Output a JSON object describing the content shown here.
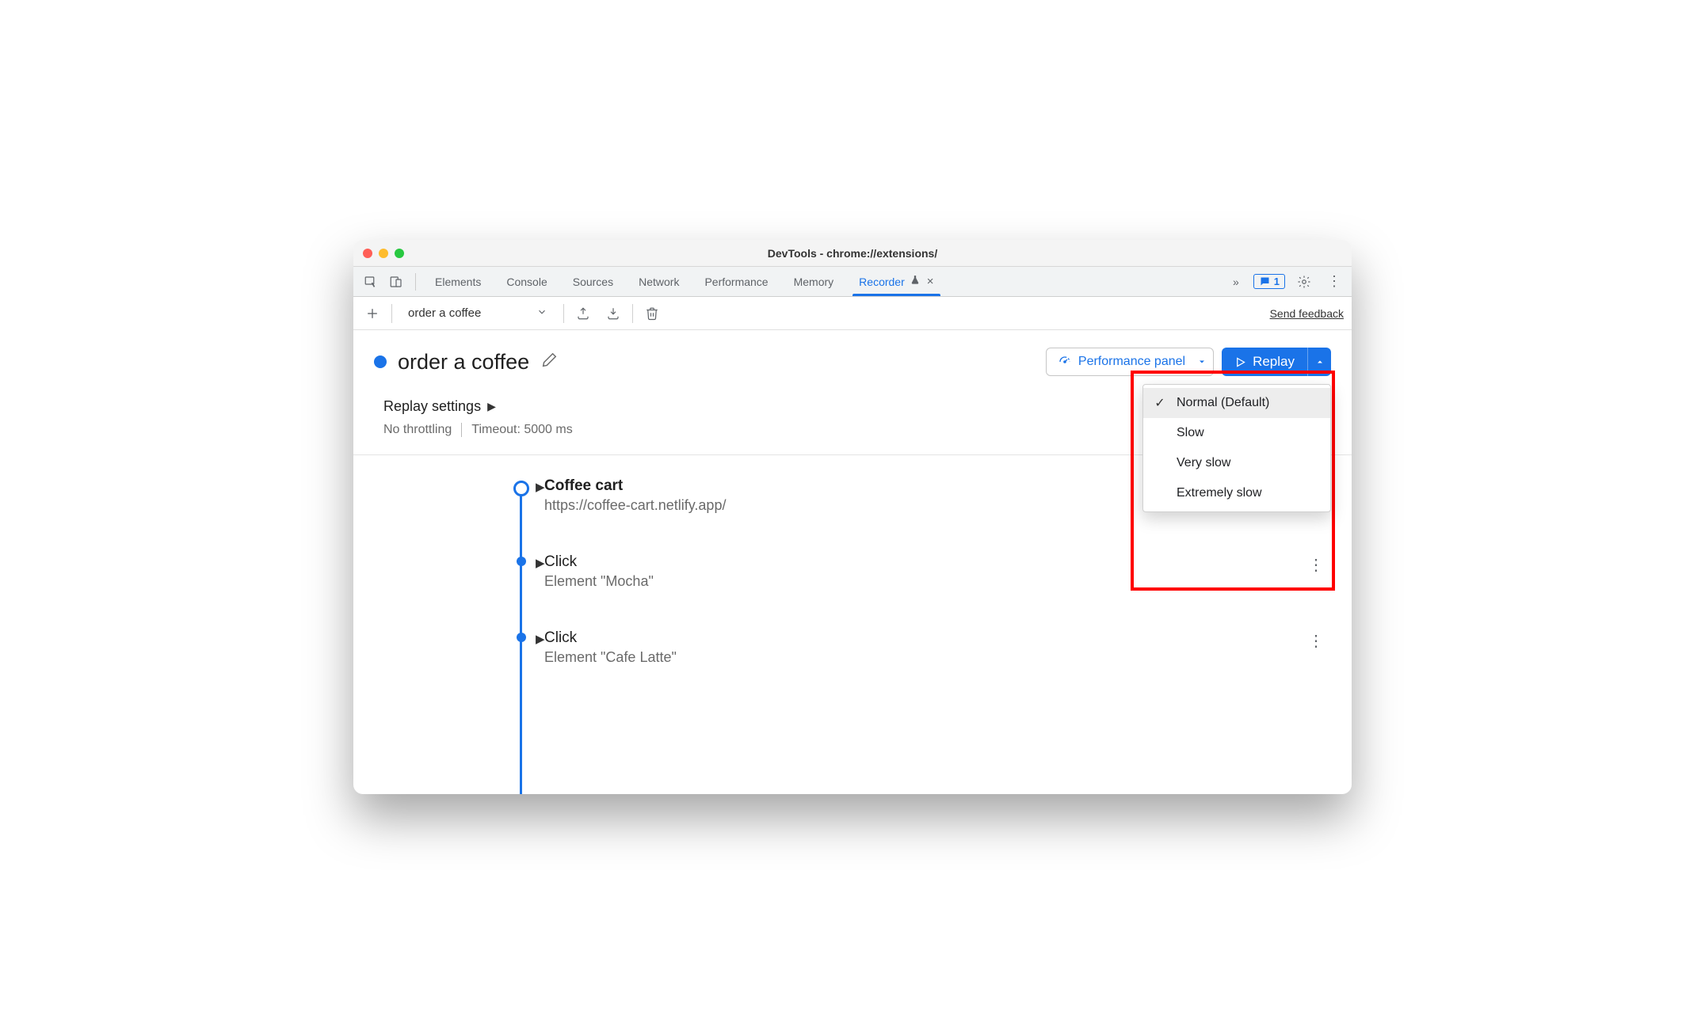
{
  "window": {
    "title": "DevTools - chrome://extensions/"
  },
  "tabs": {
    "items": [
      "Elements",
      "Console",
      "Sources",
      "Network",
      "Performance",
      "Memory",
      "Recorder"
    ],
    "activeIndex": 6,
    "feedback_count": "1"
  },
  "toolbar": {
    "recording_name": "order a coffee",
    "send_feedback": "Send feedback"
  },
  "header": {
    "title": "order a coffee",
    "performance_btn": "Performance panel",
    "replay_btn": "Replay"
  },
  "replay_menu": {
    "options": [
      "Normal (Default)",
      "Slow",
      "Very slow",
      "Extremely slow"
    ],
    "selectedIndex": 0
  },
  "settings": {
    "title": "Replay settings",
    "throttling": "No throttling",
    "timeout": "Timeout: 5000 ms"
  },
  "steps": [
    {
      "title": "Coffee cart",
      "subtitle": "https://coffee-cart.netlify.app/",
      "first": true
    },
    {
      "title": "Click",
      "subtitle": "Element \"Mocha\"",
      "first": false
    },
    {
      "title": "Click",
      "subtitle": "Element \"Cafe Latte\"",
      "first": false
    }
  ]
}
